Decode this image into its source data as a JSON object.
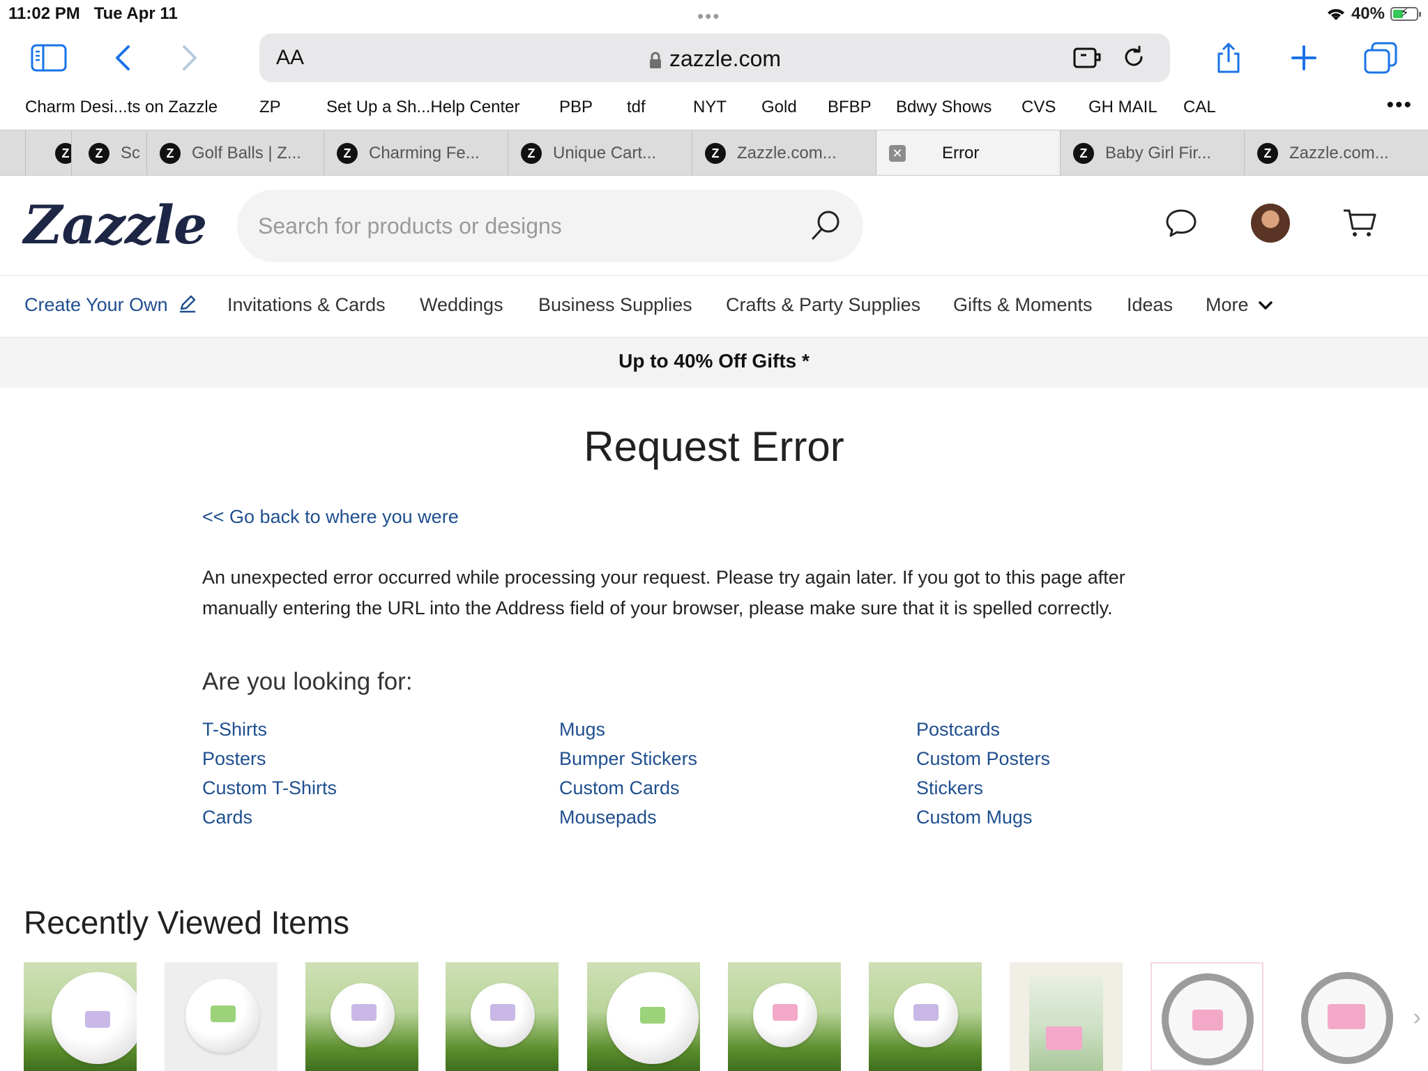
{
  "status_bar": {
    "time": "11:02 PM",
    "date": "Tue Apr 11",
    "dots": "•••",
    "battery": "40%"
  },
  "toolbar": {
    "aa_label": "AA",
    "url": "zazzle.com"
  },
  "bookmarks": [
    "Charm Desi...ts on Zazzle",
    "ZP",
    "Set Up a Sh...Help Center",
    "PBP",
    "tdf",
    "NYT",
    "Gold",
    "BFBP",
    "Bdwy Shows",
    "CVS",
    "GH MAIL",
    "CAL"
  ],
  "bookmarks_more": "•••",
  "tabs": [
    {
      "label": ""
    },
    {
      "label": "Sc"
    },
    {
      "label": "Golf Balls | Z..."
    },
    {
      "label": "Charming Fe..."
    },
    {
      "label": "Unique Cart..."
    },
    {
      "label": "Zazzle.com..."
    },
    {
      "label": "Error"
    },
    {
      "label": "Baby Girl Fir..."
    },
    {
      "label": "Zazzle.com..."
    }
  ],
  "zazzle": {
    "brand": "Zazzle",
    "search_placeholder": "Search for products or designs"
  },
  "nav": {
    "create": "Create Your Own",
    "items": [
      "Invitations & Cards",
      "Weddings",
      "Business Supplies",
      "Crafts & Party Supplies",
      "Gifts & Moments",
      "Ideas",
      "More"
    ]
  },
  "promo": "Up to 40% Off Gifts *",
  "error": {
    "title": "Request Error",
    "back_link": "<< Go back to where you were",
    "message": "An unexpected error occurred while processing your request. Please try again later. If you got to this page after manually entering the URL into the Address field of your browser, please make sure that it is spelled correctly.",
    "looking_for": "Are you looking for:"
  },
  "suggestions": {
    "col1": [
      "T-Shirts",
      "Posters",
      "Custom T-Shirts",
      "Cards"
    ],
    "col2": [
      "Mugs",
      "Bumper Stickers",
      "Custom Cards",
      "Mousepads"
    ],
    "col3": [
      "Postcards",
      "Custom Posters",
      "Stickers",
      "Custom Mugs"
    ]
  },
  "recently_viewed": {
    "title": "Recently Viewed Items"
  },
  "colors": {
    "link_blue": "#1f4f8f",
    "brand_navy": "#1d2645",
    "safari_blue": "#1a73e8"
  }
}
